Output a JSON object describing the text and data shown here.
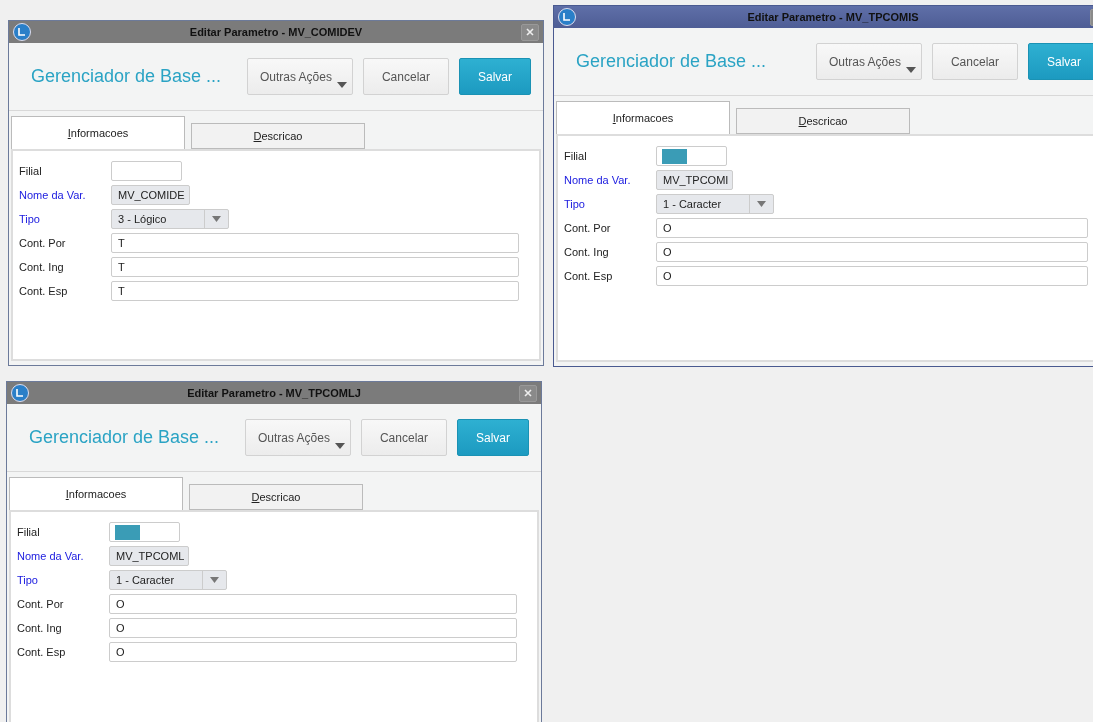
{
  "windows": [
    {
      "title": "Editar Parametro - MV_COMIDEV",
      "active": false,
      "heading": "Gerenciador de Base ...",
      "buttons": [
        {
          "label": "Outras Ações",
          "kind": "menu"
        },
        {
          "label": "Cancelar",
          "kind": "plain"
        },
        {
          "label": "Salvar",
          "kind": "primary"
        }
      ],
      "tabs": [
        {
          "label": "Informacoes",
          "selected": true
        },
        {
          "label": "Descricao",
          "selected": false
        }
      ],
      "fields": [
        {
          "label": "Filial",
          "kind": "short",
          "required": false,
          "highlighted": false
        },
        {
          "label": "Nome da Var.",
          "kind": "readonly",
          "required": true,
          "value": "MV_COMIDE"
        },
        {
          "label": "Tipo",
          "kind": "select",
          "required": true,
          "value": "3 - Lógico"
        },
        {
          "label": "Cont. Por",
          "kind": "text",
          "required": false,
          "value": "T"
        },
        {
          "label": "Cont. Ing",
          "kind": "text",
          "required": false,
          "value": "T"
        },
        {
          "label": "Cont. Esp",
          "kind": "text",
          "required": false,
          "value": "T"
        }
      ]
    },
    {
      "title": "Editar Parametro - MV_TPCOMIS",
      "active": true,
      "heading": "Gerenciador de Base ...",
      "buttons": [
        {
          "label": "Outras Ações",
          "kind": "menu"
        },
        {
          "label": "Cancelar",
          "kind": "plain"
        },
        {
          "label": "Salvar",
          "kind": "primary"
        }
      ],
      "tabs": [
        {
          "label": "Informacoes",
          "selected": true
        },
        {
          "label": "Descricao",
          "selected": false
        }
      ],
      "fields": [
        {
          "label": "Filial",
          "kind": "short",
          "required": false,
          "highlighted": true
        },
        {
          "label": "Nome da Var.",
          "kind": "readonly",
          "required": true,
          "value": "MV_TPCOMI"
        },
        {
          "label": "Tipo",
          "kind": "select",
          "required": true,
          "value": "1 - Caracter"
        },
        {
          "label": "Cont. Por",
          "kind": "text",
          "required": false,
          "value": "O"
        },
        {
          "label": "Cont. Ing",
          "kind": "text",
          "required": false,
          "value": "O"
        },
        {
          "label": "Cont. Esp",
          "kind": "text",
          "required": false,
          "value": "O"
        }
      ]
    },
    {
      "title": "Editar Parametro - MV_TPCOMLJ",
      "active": false,
      "heading": "Gerenciador de Base ...",
      "buttons": [
        {
          "label": "Outras Ações",
          "kind": "menu"
        },
        {
          "label": "Cancelar",
          "kind": "plain"
        },
        {
          "label": "Salvar",
          "kind": "primary"
        }
      ],
      "tabs": [
        {
          "label": "Informacoes",
          "selected": true
        },
        {
          "label": "Descricao",
          "selected": false
        }
      ],
      "fields": [
        {
          "label": "Filial",
          "kind": "short",
          "required": false,
          "highlighted": true
        },
        {
          "label": "Nome da Var.",
          "kind": "readonly",
          "required": true,
          "value": "MV_TPCOML"
        },
        {
          "label": "Tipo",
          "kind": "select",
          "required": true,
          "value": "1 - Caracter"
        },
        {
          "label": "Cont. Por",
          "kind": "text",
          "required": false,
          "value": "O"
        },
        {
          "label": "Cont. Ing",
          "kind": "text",
          "required": false,
          "value": "O"
        },
        {
          "label": "Cont. Esp",
          "kind": "text",
          "required": false,
          "value": "O"
        }
      ]
    }
  ]
}
